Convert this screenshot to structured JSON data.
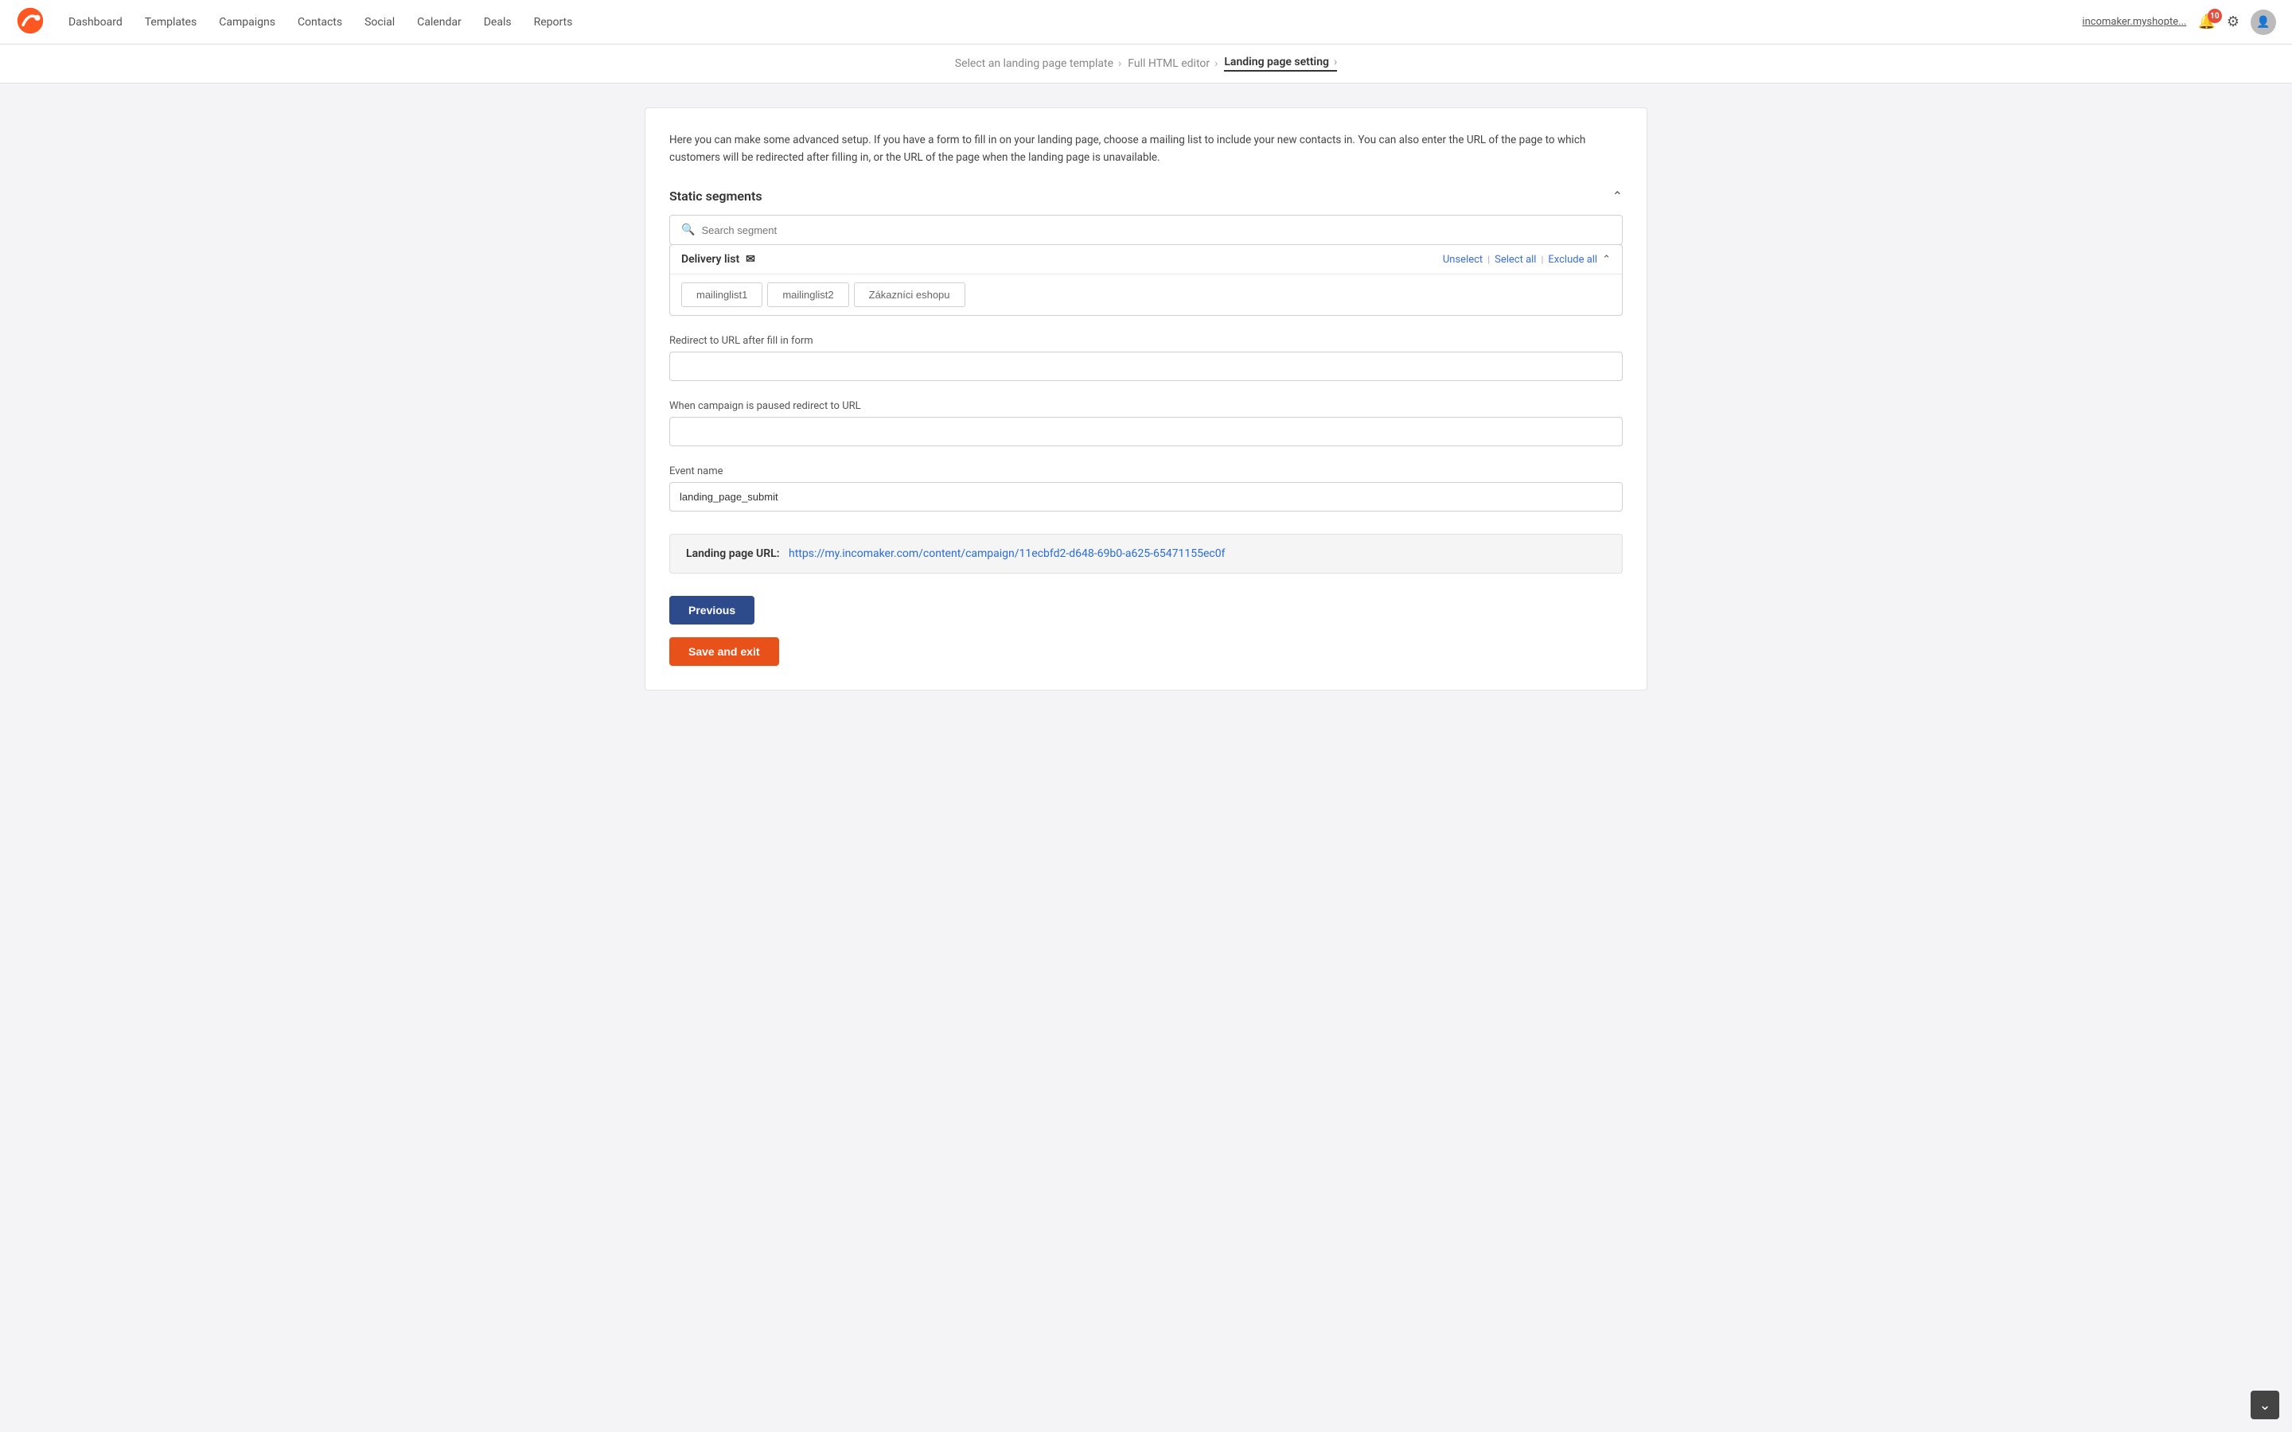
{
  "nav": {
    "logo_alt": "Incomaker logo",
    "links": [
      {
        "label": "Dashboard",
        "id": "dashboard"
      },
      {
        "label": "Templates",
        "id": "templates"
      },
      {
        "label": "Campaigns",
        "id": "campaigns"
      },
      {
        "label": "Contacts",
        "id": "contacts"
      },
      {
        "label": "Social",
        "id": "social"
      },
      {
        "label": "Calendar",
        "id": "calendar"
      },
      {
        "label": "Deals",
        "id": "deals"
      },
      {
        "label": "Reports",
        "id": "reports"
      }
    ],
    "user_link": "incomaker.myshopte...",
    "notification_count": "10"
  },
  "breadcrumb": {
    "steps": [
      {
        "label": "Select an landing page template",
        "active": false
      },
      {
        "label": "Full HTML editor",
        "active": false
      },
      {
        "label": "Landing page setting",
        "active": true
      }
    ]
  },
  "page": {
    "description": "Here you can make some advanced setup. If you have a form to fill in on your landing page, choose a mailing list to include your new contacts in. You can also enter the URL of the page to which customers will be redirected after filling in, or the URL of the page when the landing page is unavailable.",
    "static_segments_title": "Static segments",
    "search_placeholder": "Search segment",
    "delivery_list": {
      "title": "Delivery list",
      "unselect_label": "Unselect",
      "select_all_label": "Select all",
      "exclude_all_label": "Exclude all",
      "items": [
        {
          "label": "mailinglist1"
        },
        {
          "label": "mailinglist2"
        },
        {
          "label": "Zákazníci eshopu"
        }
      ]
    },
    "redirect_url_label": "Redirect to URL after fill in form",
    "redirect_url_placeholder": "",
    "paused_redirect_label": "When campaign is paused redirect to URL",
    "paused_redirect_placeholder": "",
    "event_name_label": "Event name",
    "event_name_value": "landing_page_submit",
    "lp_url_label": "Landing page URL:",
    "lp_url_value": "https://my.incomaker.com/content/campaign/11ecbfd2-d648-69b0-a625-65471155ec0f",
    "btn_previous": "Previous",
    "btn_save": "Save and exit"
  }
}
